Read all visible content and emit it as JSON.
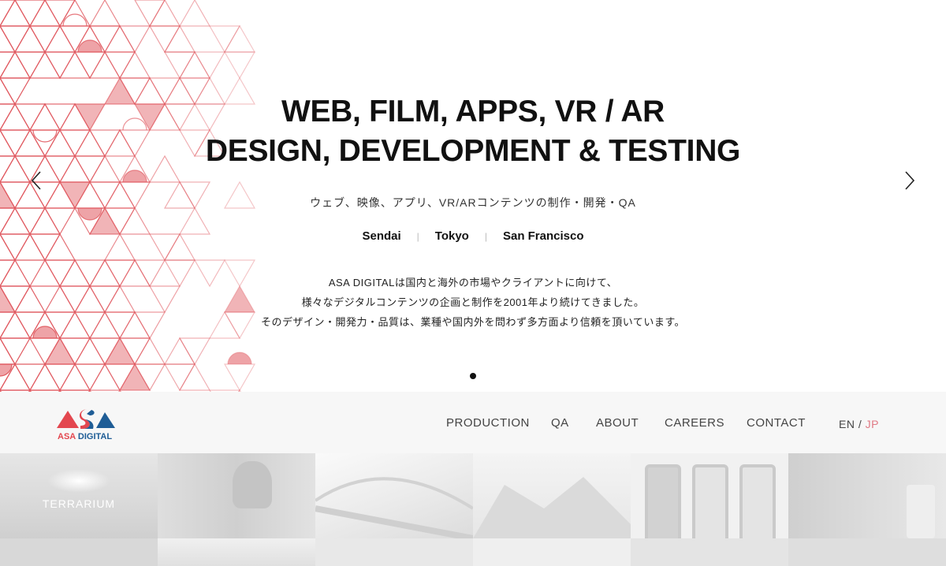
{
  "hero": {
    "headline_1": "WEB, FILM, APPS, VR / AR",
    "headline_2": "DESIGN, DEVELOPMENT & TESTING",
    "subtitle": "ウェブ、映像、アプリ、VR/ARコンテンツの制作・開発・QA",
    "cities": [
      "Sendai",
      "Tokyo",
      "San Francisco"
    ],
    "city_separator": "|",
    "paragraph": [
      "ASA DIGITALは国内と海外の市場やクライアントに向けて、",
      "様々なデジタルコンテンツの企画と制作を2001年より続けてきました。",
      "そのデザイン・開発力・品質は、業種や国内外を問わず多方面より信頼を頂いています。"
    ],
    "prev_icon": "chevron-left-icon",
    "next_icon": "chevron-right-icon",
    "slides_total": 1,
    "slide_active": 1,
    "colors": {
      "left_pattern": "#e0585f",
      "right_pattern": "#4f7fad"
    }
  },
  "header": {
    "logo_text": "ASA DIGITAL",
    "logo_colors": {
      "red": "#e3474f",
      "blue": "#1f5d96"
    },
    "nav": [
      "PRODUCTION",
      "QA",
      "ABOUT",
      "CAREERS",
      "CONTACT"
    ],
    "lang_en": "EN",
    "lang_sep": "/",
    "lang_jp": "JP",
    "lang_active_color": "#e07a85"
  },
  "thumbnails": {
    "items": [
      "TERRARIUM",
      "",
      "",
      "",
      "",
      ""
    ]
  }
}
